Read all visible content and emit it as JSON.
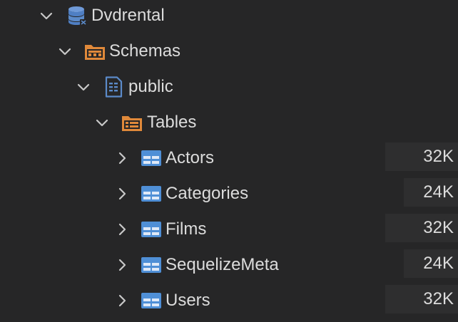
{
  "tree": {
    "database": {
      "label": "Dvdrental",
      "icon": "database-icon",
      "expanded": true
    },
    "schemas": {
      "label": "Schemas",
      "icon": "schemas-folder-icon",
      "expanded": true
    },
    "schema": {
      "label": "public",
      "icon": "schema-document-icon",
      "expanded": true
    },
    "tables_folder": {
      "label": "Tables",
      "icon": "tables-folder-icon",
      "expanded": true
    },
    "tables": [
      {
        "label": "Actors",
        "size": "32K",
        "icon": "table-icon",
        "expanded": false
      },
      {
        "label": "Categories",
        "size": "24K",
        "icon": "table-icon",
        "expanded": false
      },
      {
        "label": "Films",
        "size": "32K",
        "icon": "table-icon",
        "expanded": false
      },
      {
        "label": "SequelizeMeta",
        "size": "24K",
        "icon": "table-icon",
        "expanded": false
      },
      {
        "label": "Users",
        "size": "32K",
        "icon": "table-icon",
        "expanded": false
      }
    ]
  },
  "colors": {
    "background": "#262627",
    "size_background": "#2e2e2f",
    "text": "#dcdcdc",
    "chevron": "#c8c8c8",
    "database_icon": "#5b8ac9",
    "folder_icon": "#e0893a",
    "table_icon": "#4f8fd6"
  }
}
